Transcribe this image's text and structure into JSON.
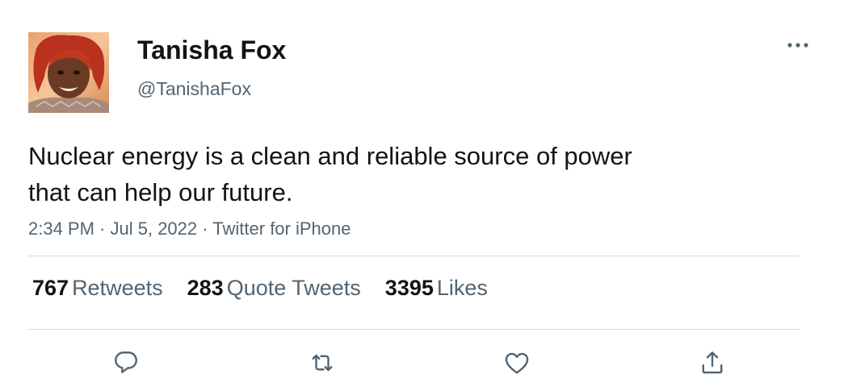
{
  "author": {
    "display_name": "Tanisha Fox",
    "handle": "@TanishaFox"
  },
  "tweet": {
    "text": "Nuclear energy is a clean and reliable source of power\nthat can help our future."
  },
  "meta": {
    "time": "2:34 PM",
    "separator1": " · ",
    "date": "Jul 5, 2022",
    "separator2": " · ",
    "source": "Twitter for iPhone"
  },
  "stats": {
    "retweets": {
      "count": "767",
      "label": "Retweets"
    },
    "quote_tweets": {
      "count": "283",
      "label": "Quote Tweets"
    },
    "likes": {
      "count": "3395",
      "label": "Likes"
    }
  },
  "actions": {
    "reply": "reply-icon",
    "retweet": "retweet-icon",
    "like": "heart-icon",
    "share": "share-icon"
  },
  "colors": {
    "text_primary": "#0f1419",
    "text_secondary": "#536471",
    "divider": "#cfd9de",
    "icon": "#536471"
  }
}
